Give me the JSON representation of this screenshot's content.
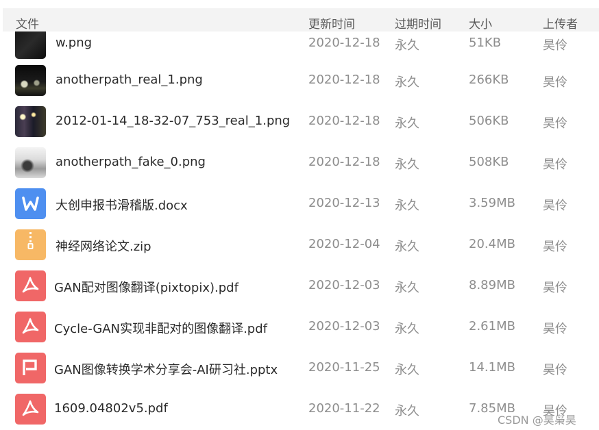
{
  "header": {
    "col_name": "文件",
    "col_updated": "更新时间",
    "col_expire": "过期时间",
    "col_size": "大小",
    "col_uploader": "上传者"
  },
  "files": [
    {
      "name": "w.png",
      "updated": "2020-12-18",
      "expire": "永久",
      "size": "51KB",
      "uploader": "昊伶",
      "thumb": "image-dark-thumbnail"
    },
    {
      "name": "anotherpath_real_1.png",
      "updated": "2020-12-18",
      "expire": "永久",
      "size": "266KB",
      "uploader": "昊伶",
      "thumb": "image-night-thumbnail"
    },
    {
      "name": "2012-01-14_18-32-07_753_real_1.png",
      "updated": "2020-12-18",
      "expire": "永久",
      "size": "506KB",
      "uploader": "昊伶",
      "thumb": "image-street-thumbnail"
    },
    {
      "name": "anotherpath_fake_0.png",
      "updated": "2020-12-18",
      "expire": "永久",
      "size": "508KB",
      "uploader": "昊伶",
      "thumb": "image-gray-thumbnail"
    },
    {
      "name": "大创申报书滑稽版.docx",
      "updated": "2020-12-13",
      "expire": "永久",
      "size": "3.59MB",
      "uploader": "昊伶",
      "thumb": "word-icon"
    },
    {
      "name": "神经网络论文.zip",
      "updated": "2020-12-04",
      "expire": "永久",
      "size": "20.4MB",
      "uploader": "昊伶",
      "thumb": "zip-icon"
    },
    {
      "name": "GAN配对图像翻译(pixtopix).pdf",
      "updated": "2020-12-03",
      "expire": "永久",
      "size": "8.89MB",
      "uploader": "昊伶",
      "thumb": "pdf-icon"
    },
    {
      "name": "Cycle-GAN实现非配对的图像翻译.pdf",
      "updated": "2020-12-03",
      "expire": "永久",
      "size": "2.61MB",
      "uploader": "昊伶",
      "thumb": "pdf-icon"
    },
    {
      "name": "GAN图像转换学术分享会-AI研习社.pptx",
      "updated": "2020-11-25",
      "expire": "永久",
      "size": "14.1MB",
      "uploader": "昊伶",
      "thumb": "ppt-icon"
    },
    {
      "name": "1609.04802v5.pdf",
      "updated": "2020-11-22",
      "expire": "永久",
      "size": "7.85MB",
      "uploader": "昊伶",
      "thumb": "pdf-icon"
    }
  ],
  "watermark": "CSDN @昊枭昊",
  "colors": {
    "header_bg": "#f3f3f3",
    "pdf": "#f06767",
    "word": "#4e8ff0",
    "zip": "#f7b865"
  }
}
